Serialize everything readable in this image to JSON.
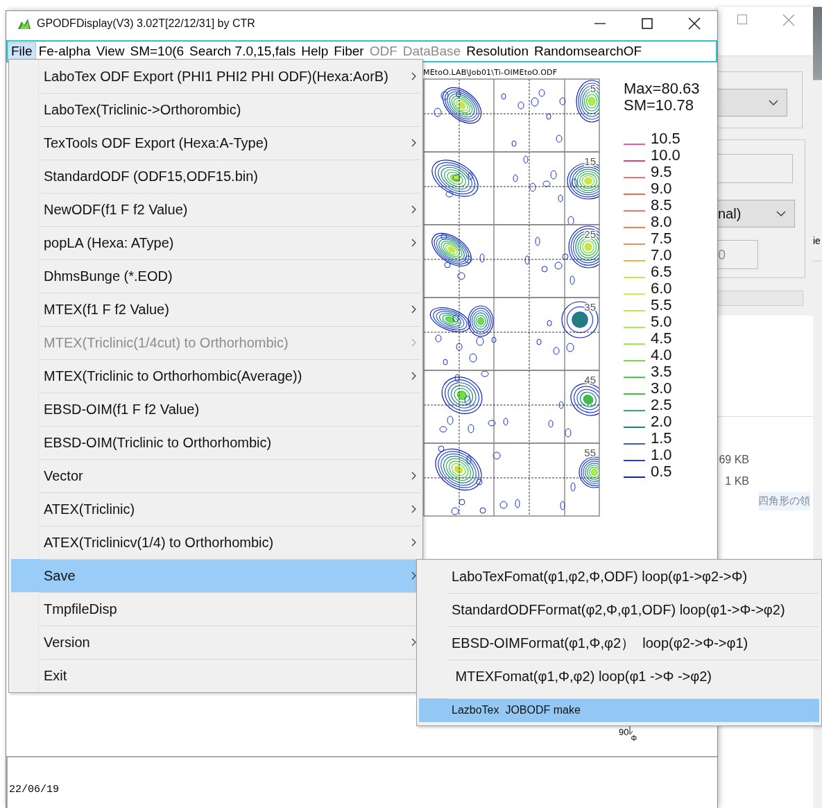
{
  "window": {
    "title": "GPODFDisplay(V3) 3.02T[22/12/31] by CTR"
  },
  "menu_bar": [
    {
      "label": "File",
      "selected": true,
      "disabled": false
    },
    {
      "label": "Fe-alpha",
      "selected": false,
      "disabled": false
    },
    {
      "label": "View",
      "selected": false,
      "disabled": false
    },
    {
      "label": "SM=10(6",
      "selected": false,
      "disabled": false
    },
    {
      "label": "Search 7.0,15,fals",
      "selected": false,
      "disabled": false
    },
    {
      "label": "Help",
      "selected": false,
      "disabled": false
    },
    {
      "label": "Fiber",
      "selected": false,
      "disabled": false
    },
    {
      "label": "ODF",
      "selected": false,
      "disabled": true
    },
    {
      "label": "DataBase",
      "selected": false,
      "disabled": true
    },
    {
      "label": "Resolution",
      "selected": false,
      "disabled": false
    },
    {
      "label": "RandomsearchOF",
      "selected": false,
      "disabled": false
    }
  ],
  "file_menu": [
    {
      "label": "LaboTex ODF Export (PHI1 PHI2 PHI ODF)(Hexa:AorB)",
      "has_submenu": true,
      "disabled": false,
      "selected": false
    },
    {
      "label": "LaboTex(Triclinic->Orthorombic)",
      "has_submenu": false,
      "disabled": false,
      "selected": false
    },
    {
      "label": "TexTools ODF Export (Hexa:A-Type)",
      "has_submenu": true,
      "disabled": false,
      "selected": false
    },
    {
      "label": "StandardODF (ODF15,ODF15.bin)",
      "has_submenu": false,
      "disabled": false,
      "selected": false
    },
    {
      "label": "NewODF(f1 F f2 Value)",
      "has_submenu": true,
      "disabled": false,
      "selected": false
    },
    {
      "label": "popLA (Hexa: AType)",
      "has_submenu": true,
      "disabled": false,
      "selected": false
    },
    {
      "label": "DhmsBunge (*.EOD)",
      "has_submenu": false,
      "disabled": false,
      "selected": false
    },
    {
      "label": "MTEX(f1 F f2 Value)",
      "has_submenu": true,
      "disabled": false,
      "selected": false
    },
    {
      "label": "MTEX(Triclinic(1/4cut) to Orthorhombic)",
      "has_submenu": true,
      "disabled": true,
      "selected": false
    },
    {
      "label": "MTEX(Triclinic to Orthorhombic(Average))",
      "has_submenu": true,
      "disabled": false,
      "selected": false
    },
    {
      "label": "EBSD-OIM(f1 F f2 Value)",
      "has_submenu": false,
      "disabled": false,
      "selected": false
    },
    {
      "label": "EBSD-OIM(Triclinic to Orthorhombic)",
      "has_submenu": false,
      "disabled": false,
      "selected": false
    },
    {
      "label": "Vector",
      "has_submenu": true,
      "disabled": false,
      "selected": false
    },
    {
      "label": "ATEX(Triclinic)",
      "has_submenu": true,
      "disabled": false,
      "selected": false
    },
    {
      "label": "ATEX(Triclinicv(1/4) to Orthorhombic)",
      "has_submenu": true,
      "disabled": false,
      "selected": false
    },
    {
      "label": "Save",
      "has_submenu": true,
      "disabled": false,
      "selected": true
    },
    {
      "label": "TmpfileDisp",
      "has_submenu": false,
      "disabled": false,
      "selected": false
    },
    {
      "label": "Version",
      "has_submenu": true,
      "disabled": false,
      "selected": false
    },
    {
      "label": "Exit",
      "has_submenu": false,
      "disabled": false,
      "selected": false
    }
  ],
  "save_submenu": [
    {
      "label": "LaboTexFomat(φ1,φ2,Φ,ODF) loop(φ1->φ2->Φ)",
      "selected": false
    },
    {
      "label": "StandardODFFormat(φ2,Φ,φ1,ODF) loop(φ1->Φ->φ2)",
      "selected": false
    },
    {
      "label": "EBSD-OIMFormat(φ1,Φ,φ2）  loop(φ2->Φ->φ1)",
      "selected": false
    },
    {
      "label": " MTEXFomat(φ1,Φ,φ2) loop(φ1 ->Φ ->φ2)",
      "selected": false
    },
    {
      "label": "LazboTex  JOBODF make",
      "selected": true
    }
  ],
  "plot": {
    "file_path": "MEtoO.LAB\\Job01\\Ti-OIMEtoO.ODF",
    "max": "Max=80.63",
    "sm": "SM=10.78",
    "section_labels": [
      "5",
      "15",
      "25",
      "35",
      "45",
      "55"
    ],
    "legend": [
      {
        "value": "10.5",
        "color": "#e858a8"
      },
      {
        "value": "10.0",
        "color": "#e0407c"
      },
      {
        "value": "9.5",
        "color": "#f07070"
      },
      {
        "value": "9.0",
        "color": "#f06848"
      },
      {
        "value": "8.5",
        "color": "#f07858"
      },
      {
        "value": "8.0",
        "color": "#f08050"
      },
      {
        "value": "7.5",
        "color": "#f09050"
      },
      {
        "value": "7.0",
        "color": "#f0b040"
      },
      {
        "value": "6.5",
        "color": "#d8e040"
      },
      {
        "value": "6.0",
        "color": "#d0e840"
      },
      {
        "value": "5.5",
        "color": "#c8e848"
      },
      {
        "value": "5.0",
        "color": "#b0f040"
      },
      {
        "value": "4.5",
        "color": "#90f040"
      },
      {
        "value": "4.0",
        "color": "#70e040"
      },
      {
        "value": "3.5",
        "color": "#40d040"
      },
      {
        "value": "3.0",
        "color": "#40c040"
      },
      {
        "value": "2.5",
        "color": "#30a880"
      },
      {
        "value": "2.0",
        "color": "#208080"
      },
      {
        "value": "1.5",
        "color": "#3060c0"
      },
      {
        "value": "1.0",
        "color": "#2040e0"
      },
      {
        "value": "0.5",
        "color": "#1020c0"
      }
    ]
  },
  "axis": {
    "tick": "90",
    "symbol": "Φ"
  },
  "status_bar": {
    "date": "22/06/19"
  },
  "background_window": {
    "fields": [
      "nal)",
      "0"
    ],
    "clipped_label": "ie",
    "file_sizes": [
      "69 KB",
      "1 KB"
    ],
    "hint": "四角形の領"
  }
}
